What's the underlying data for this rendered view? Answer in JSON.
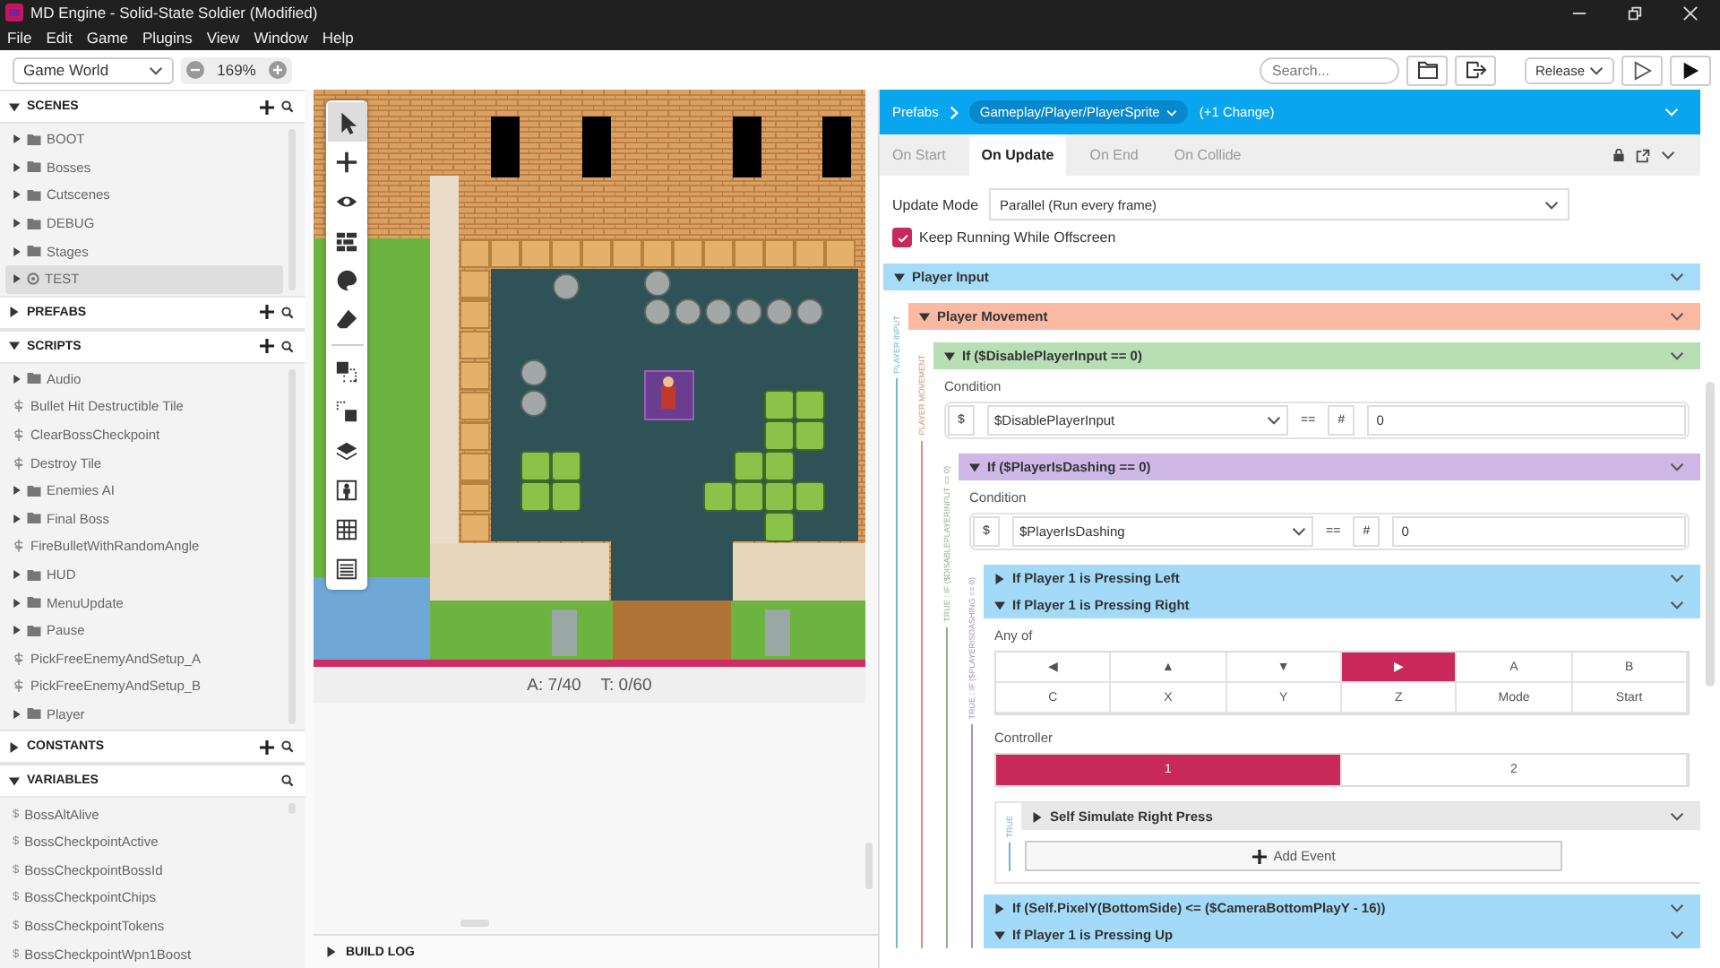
{
  "window": {
    "title": "MD Engine - Solid-State Soldier (Modified)"
  },
  "menu": [
    "File",
    "Edit",
    "Game",
    "Plugins",
    "View",
    "Window",
    "Help"
  ],
  "toolbar": {
    "world_select": "Game World",
    "zoom": "169%",
    "search": {
      "placeholder": "Search..."
    },
    "build_select": "Release"
  },
  "sidebar": {
    "sections": [
      {
        "title": "SCENES",
        "expanded": true,
        "add": true,
        "items": [
          {
            "label": "BOOT",
            "kind": "folder",
            "selected": false
          },
          {
            "label": "Bosses",
            "kind": "folder",
            "selected": false
          },
          {
            "label": "Cutscenes",
            "kind": "folder",
            "selected": false
          },
          {
            "label": "DEBUG",
            "kind": "folder",
            "selected": false
          },
          {
            "label": "Stages",
            "kind": "folder",
            "selected": false
          },
          {
            "label": "TEST",
            "kind": "scene",
            "selected": true
          }
        ]
      },
      {
        "title": "PREFABS",
        "expanded": false,
        "add": true
      },
      {
        "title": "SCRIPTS",
        "expanded": true,
        "add": true,
        "items": [
          {
            "label": "Audio",
            "kind": "folder",
            "selected": false
          },
          {
            "label": "Bullet Hit Destructible Tile",
            "kind": "script",
            "selected": false
          },
          {
            "label": "ClearBossCheckpoint",
            "kind": "script",
            "selected": false
          },
          {
            "label": "Destroy Tile",
            "kind": "script",
            "selected": false
          },
          {
            "label": "Enemies AI",
            "kind": "folder",
            "selected": false
          },
          {
            "label": "Final Boss",
            "kind": "folder",
            "selected": false
          },
          {
            "label": "FireBulletWithRandomAngle",
            "kind": "script",
            "selected": false
          },
          {
            "label": "HUD",
            "kind": "folder",
            "selected": false
          },
          {
            "label": "MenuUpdate",
            "kind": "folder",
            "selected": false
          },
          {
            "label": "Pause",
            "kind": "folder",
            "selected": false
          },
          {
            "label": "PickFreeEnemyAndSetup_A",
            "kind": "script",
            "selected": false
          },
          {
            "label": "PickFreeEnemyAndSetup_B",
            "kind": "script",
            "selected": false
          },
          {
            "label": "Player",
            "kind": "folder",
            "selected": false
          }
        ]
      },
      {
        "title": "CONSTANTS",
        "expanded": false,
        "add": true
      },
      {
        "title": "VARIABLES",
        "expanded": true,
        "add": false,
        "icon_text": "$",
        "items": [
          {
            "label": "BossAltAlive",
            "kind": "variable",
            "selected": false
          },
          {
            "label": "BossCheckpointActive",
            "kind": "variable",
            "selected": false
          },
          {
            "label": "BossCheckpointBossId",
            "kind": "variable",
            "selected": false
          },
          {
            "label": "BossCheckpointChips",
            "kind": "variable",
            "selected": false
          },
          {
            "label": "BossCheckpointTokens",
            "kind": "variable",
            "selected": false
          },
          {
            "label": "BossCheckpointWpn1Boost",
            "kind": "variable",
            "selected": false
          }
        ]
      }
    ]
  },
  "editor": {
    "tools": [
      {
        "kind": "pointer",
        "selected": true
      },
      {
        "kind": "plus",
        "selected": false
      },
      {
        "kind": "eye",
        "selected": false
      },
      {
        "kind": "brick",
        "selected": false
      },
      {
        "kind": "palette",
        "selected": false
      },
      {
        "kind": "eraser",
        "selected": false
      },
      {
        "kind": "copy-selection",
        "selected": false
      },
      {
        "kind": "paste-selection",
        "selected": false
      },
      {
        "kind": "layers",
        "selected": false
      },
      {
        "kind": "person",
        "selected": false
      },
      {
        "kind": "grid",
        "selected": false
      },
      {
        "kind": "list",
        "selected": false
      }
    ],
    "status": {
      "actors": "A: 7/40",
      "triggers": "T: 0/60"
    },
    "build_log": {
      "title": "BUILD LOG",
      "expanded": false
    }
  },
  "inspector": {
    "breadcrumb": {
      "root": "Prefabs",
      "path": "Gameplay/Player/PlayerSprite",
      "changes": "(+1 Change)"
    },
    "tabs": [
      {
        "label": "On Start",
        "selected": false
      },
      {
        "label": "On Update",
        "selected": true
      },
      {
        "label": "On End",
        "selected": false
      },
      {
        "label": "On Collide",
        "selected": false
      }
    ],
    "update_mode": {
      "label": "Update Mode",
      "value": "Parallel (Run every frame)"
    },
    "keep_running": {
      "label": "Keep Running While Offscreen",
      "checked": true
    },
    "events": [
      {
        "title": "Player Input",
        "kind": "group",
        "expanded": true,
        "color": "#a6dcf7",
        "guide_label": "PLAYER INPUT",
        "children": [
          {
            "title": "Player Movement",
            "kind": "group",
            "expanded": true,
            "color": "#f9b9a2",
            "guide_label": "PLAYER MOVEMENT",
            "children": [
              {
                "title": "If ($DisablePlayerInput == 0)",
                "kind": "if",
                "expanded": true,
                "color": "#b8deb4",
                "condition": {
                  "label": "Condition",
                  "variable_type": "$",
                  "variable": "$DisablePlayerInput",
                  "operator": "==",
                  "value_type": "#",
                  "value": "0"
                },
                "guide_label": "TRUE : IF ($DISABLEPLAYERINPUT == 0)",
                "children": [
                  {
                    "title": "If ($PlayerIsDashing == 0)",
                    "kind": "if",
                    "expanded": true,
                    "color": "#cfb8e8",
                    "condition": {
                      "label": "Condition",
                      "variable_type": "$",
                      "variable": "$PlayerIsDashing",
                      "operator": "==",
                      "value_type": "#",
                      "value": "0"
                    },
                    "guide_label": "TRUE : IF ($PLAYERISDASHING == 0)",
                    "children": [
                      {
                        "title": "If Player 1 is Pressing Left",
                        "kind": "input",
                        "expanded": false,
                        "color": "#a3daf8"
                      },
                      {
                        "title": "If Player 1 is Pressing Right",
                        "kind": "input",
                        "expanded": true,
                        "color": "#a3daf8",
                        "any_of_label": "Any of",
                        "buttons": [
                          {
                            "label": "◀",
                            "selected": false
                          },
                          {
                            "label": "▲",
                            "selected": false
                          },
                          {
                            "label": "▼",
                            "selected": false
                          },
                          {
                            "label": "▶",
                            "selected": true
                          },
                          {
                            "label": "A",
                            "selected": false
                          },
                          {
                            "label": "B",
                            "selected": false
                          },
                          {
                            "label": "C",
                            "selected": false
                          },
                          {
                            "label": "X",
                            "selected": false
                          },
                          {
                            "label": "Y",
                            "selected": false
                          },
                          {
                            "label": "Z",
                            "selected": false
                          },
                          {
                            "label": "Mode",
                            "selected": false
                          },
                          {
                            "label": "Start",
                            "selected": false
                          }
                        ],
                        "controller_label": "Controller",
                        "controllers": [
                          {
                            "label": "1",
                            "selected": true
                          },
                          {
                            "label": "2",
                            "selected": false
                          }
                        ],
                        "guide_label": "TRUE",
                        "add_event": "Add Event",
                        "children": [
                          {
                            "title": "Self Simulate Right Press",
                            "kind": "action",
                            "expanded": false,
                            "color": "#e8e8e8"
                          }
                        ]
                      },
                      {
                        "title": "If (Self.PixelY(BottomSide) <= ($CameraBottomPlayY - 16))",
                        "kind": "if",
                        "expanded": false,
                        "color": "#a3daf8"
                      },
                      {
                        "title": "If Player 1 is Pressing Up",
                        "kind": "input",
                        "expanded": true,
                        "color": "#a3daf8"
                      }
                    ]
                  }
                ]
              }
            ]
          }
        ]
      }
    ]
  }
}
